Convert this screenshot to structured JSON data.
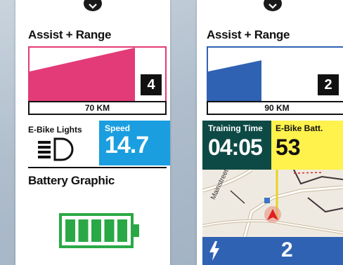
{
  "colors": {
    "pink": "#e33b77",
    "blue": "#2f62b3",
    "cyan": "#1a9ee0",
    "green": "#2aa845",
    "dark_teal": "#0e4a45",
    "yellow": "#fff24d"
  },
  "left_screen": {
    "assist_title": "Assist + Range",
    "assist_level": "4",
    "assist_fill": 0.78,
    "range": "70 KM",
    "lights_label": "E-Bike Lights",
    "lights_icon": "headlight-icon",
    "speed_label": "Speed",
    "speed_value": "14.7",
    "battery_title": "Battery Graphic",
    "battery_segments_filled": 5,
    "battery_segments_total": 5
  },
  "right_screen": {
    "assist_title": "Assist + Range",
    "assist_level": "2",
    "assist_fill": 0.45,
    "range": "90 KM",
    "training_time_label": "Training Time",
    "training_time_value": "04:05",
    "ebike_batt_label": "E-Bike Batt.",
    "ebike_batt_value": "53",
    "map_street": "Mainstreet",
    "bottom_icon": "lightning-icon",
    "bottom_value": "2"
  }
}
